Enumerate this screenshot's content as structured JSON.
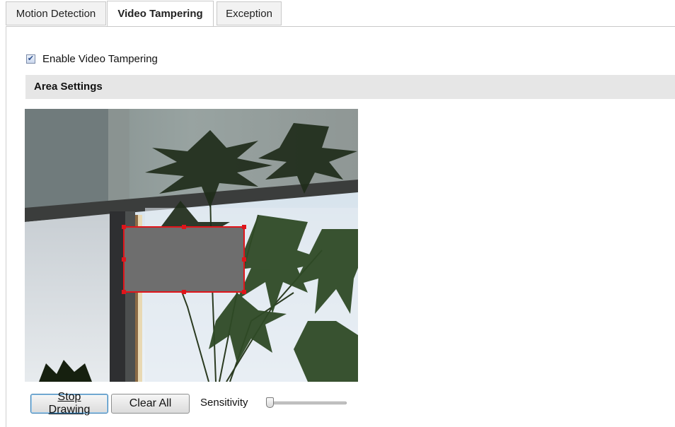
{
  "tabs": [
    {
      "label": "Motion Detection",
      "active": false
    },
    {
      "label": "Video Tampering",
      "active": true
    },
    {
      "label": "Exception",
      "active": false
    }
  ],
  "enable": {
    "label": "Enable Video Tampering",
    "checked": true
  },
  "area_settings": {
    "title": "Area Settings"
  },
  "video": {
    "region_fill": "#6e6e6e",
    "region_border": "#e0151b"
  },
  "buttons": {
    "stop_drawing": "Stop Drawing",
    "clear_all": "Clear All"
  },
  "sensitivity": {
    "label": "Sensitivity",
    "value": 0
  }
}
